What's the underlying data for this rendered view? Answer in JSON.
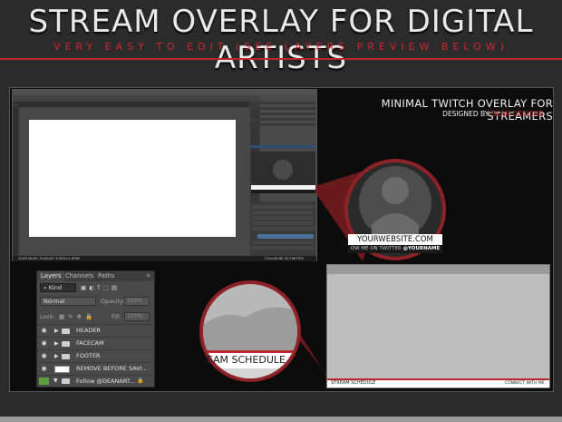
{
  "header": {
    "title": "STREAM OVERLAY FOR DIGITAL ARTISTS",
    "subtitle": "VERY EASY TO EDIT (SEE LAYERS PREVIEW BELOW)"
  },
  "overlay_caption": {
    "title": "MINIMAL TWITCH OVERLAY FOR STREAMERS",
    "designed_by": "DESIGNED BY",
    "designer": "DEAN DESIGNS"
  },
  "photoshop": {
    "status_text": "YOUR MUSIC PLAYLIST SCROLLS HERE",
    "status_right": "FOLLOW ME ON TWITTER"
  },
  "zoom_facecam": {
    "website": "YOURWEBSITE.COM",
    "follow_prefix": "OW ME ON TWITTER",
    "follow_handle": "@YOURNAME"
  },
  "zoom_schedule": {
    "label": "EAM SCHEDULE"
  },
  "layers_panel": {
    "tabs": [
      "Layers",
      "Channels",
      "Paths"
    ],
    "kind_label": "Kind",
    "blend_mode": "Normal",
    "opacity_label": "Opacity:",
    "opacity_value": "100%",
    "lock_label": "Lock:",
    "fill_label": "Fill:",
    "fill_value": "100%",
    "rows": [
      {
        "name": "HEADER"
      },
      {
        "name": "FACECAM"
      },
      {
        "name": "FOOTER"
      },
      {
        "name": "REMOVE BEFORE SAVI..."
      },
      {
        "name": "Follow @DEANART..."
      }
    ]
  },
  "preview": {
    "schedule": "STREAM SCHEDULE",
    "connect": "CONNECT WITH ME"
  },
  "colors": {
    "accent": "#b9282d",
    "dark": "#0c0c0c",
    "header_bg": "#2b2b2b"
  }
}
